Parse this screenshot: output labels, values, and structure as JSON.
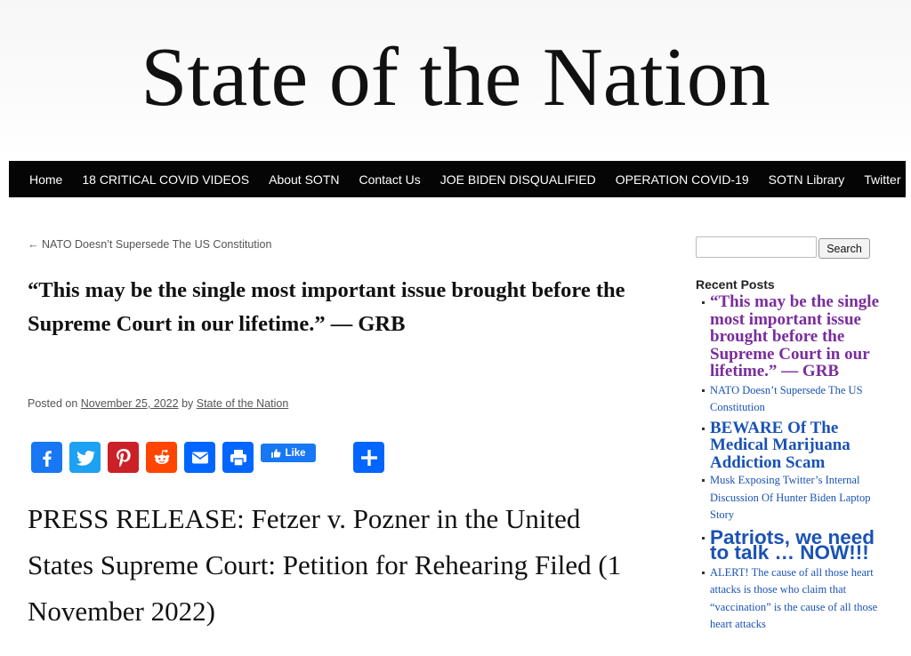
{
  "site": {
    "title": "State of the Nation"
  },
  "nav": [
    "Home",
    "18 CRITICAL COVID VIDEOS",
    "About SOTN",
    "Contact Us",
    "JOE BIDEN DISQUALIFIED",
    "OPERATION COVID-19",
    "SOTN Library",
    "Twitter"
  ],
  "post": {
    "prev_link": "← NATO Doesn’t Supersede The US Constitution",
    "title": "“This may be the single most important issue brought before the Supreme Court in our lifetime.” — GRB",
    "meta_prefix": "Posted on",
    "date": "November 25, 2022",
    "meta_by": "by",
    "author": "State of the Nation",
    "headline": "PRESS RELEASE: Fetzer v. Pozner in the United States Supreme Court: Petition for Rehearing Filed (1 November 2022)"
  },
  "share": {
    "like_label": "Like",
    "buttons": [
      {
        "icon": "facebook-icon",
        "color": "#1877f2"
      },
      {
        "icon": "twitter-icon",
        "color": "#1da1f2"
      },
      {
        "icon": "pinterest-icon",
        "color": "#cb2027"
      },
      {
        "icon": "reddit-icon",
        "color": "#ff4500"
      },
      {
        "icon": "email-icon",
        "color": "#0166ff"
      },
      {
        "icon": "print-icon",
        "color": "#0166ff"
      },
      {
        "icon": "add-share-icon",
        "color": "#0166ff"
      }
    ]
  },
  "sidebar": {
    "search_button": "Search",
    "search_value": "",
    "recent_heading": "Recent Posts",
    "recent": [
      "“This may be the single most important issue brought before the Supreme Court in our lifetime.” — GRB",
      "NATO Doesn’t Supersede The US Constitution",
      "BEWARE Of The Medical Marijuana Addiction Scam",
      "Musk Exposing Twitter’s Internal Discussion Of Hunter Biden Laptop Story",
      "Patriots, we need to talk … NOW!!!",
      "ALERT! The cause of all those heart attacks is those who claim that “vaccination” is the cause of all those heart attacks"
    ]
  }
}
